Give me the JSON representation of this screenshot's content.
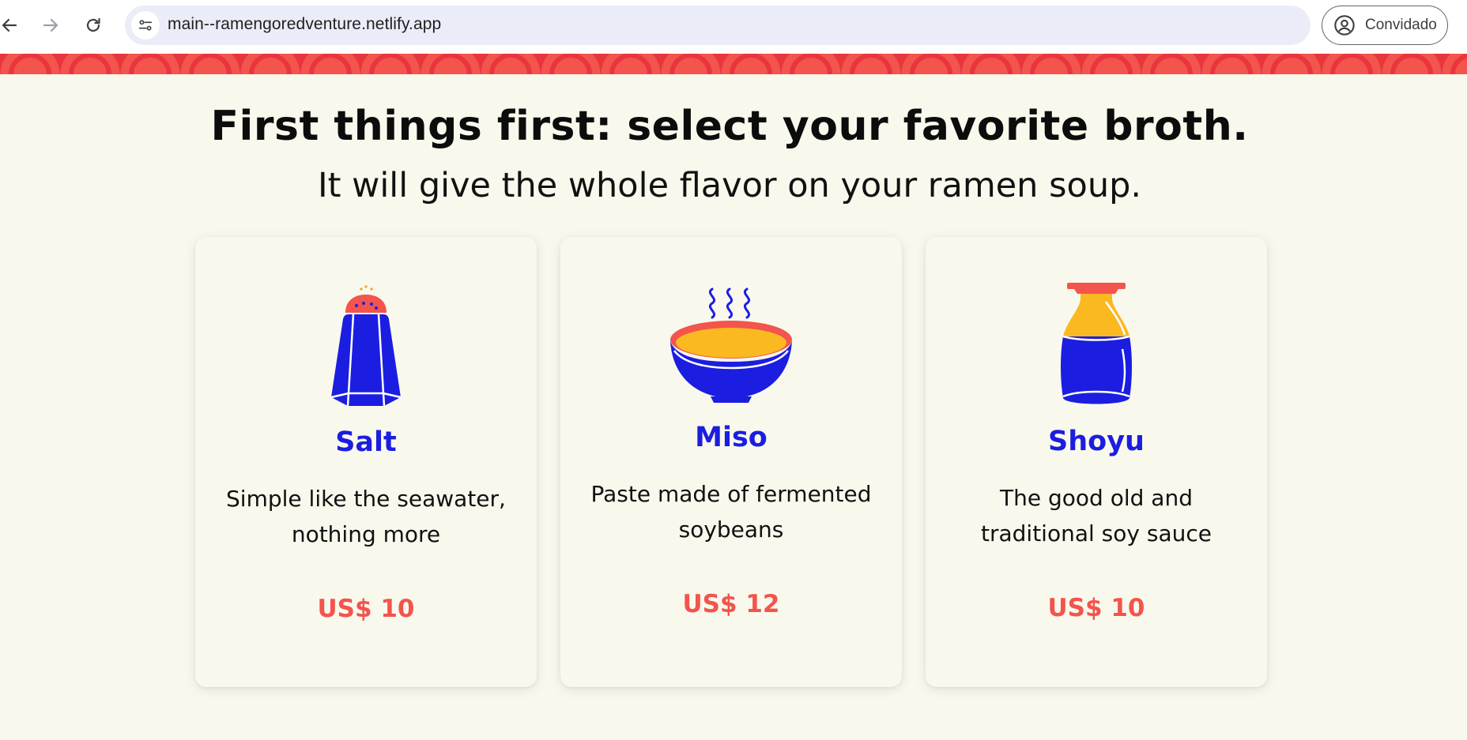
{
  "browser": {
    "url": "main--ramengoredventure.netlify.app",
    "profile_label": "Convidado"
  },
  "page": {
    "heading": "First things first: select your favorite broth.",
    "subheading": "It will give the whole flavor on your ramen soup."
  },
  "colors": {
    "accent_blue": "#1b1ee0",
    "accent_red": "#f3544c",
    "accent_yellow": "#fbb921",
    "background": "#f9f8ec"
  },
  "broths": [
    {
      "name": "Salt",
      "description": "Simple like the seawater, nothing more",
      "price": "US$ 10",
      "icon": "salt-shaker-icon"
    },
    {
      "name": "Miso",
      "description": "Paste made of fermented soybeans",
      "price": "US$ 12",
      "icon": "miso-bowl-icon"
    },
    {
      "name": "Shoyu",
      "description": "The good old and traditional soy sauce",
      "price": "US$ 10",
      "icon": "soy-sauce-bottle-icon"
    }
  ]
}
